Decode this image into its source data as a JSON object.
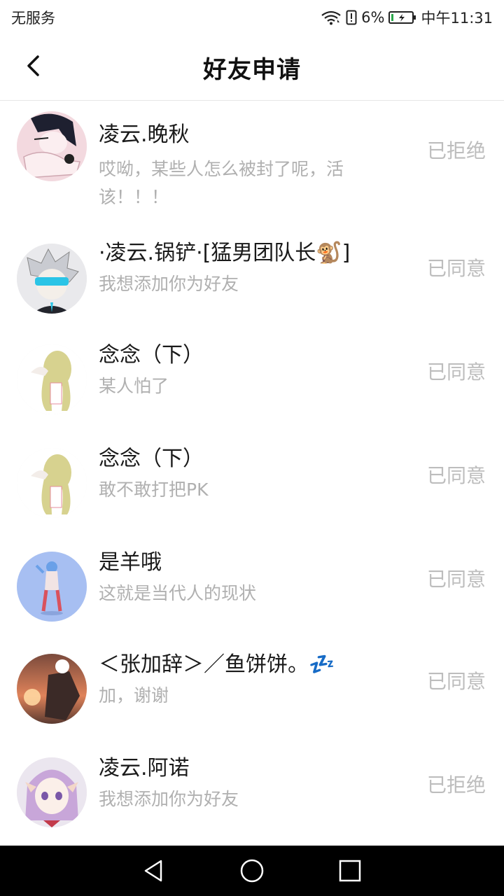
{
  "status_bar": {
    "carrier": "无服务",
    "battery_percent": "6%",
    "time": "中午11:31",
    "icons": [
      "wifi-icon",
      "alert-icon",
      "battery-icon"
    ]
  },
  "header": {
    "title": "好友申请",
    "back_icon": "chevron-left-icon"
  },
  "requests": [
    {
      "name": "凌云.晚秋",
      "message": "哎呦，某些人怎么被封了呢，活该！！！",
      "status": "已拒绝",
      "avatar": "anime-girl-avatar"
    },
    {
      "name": "·凌云.锅铲·[猛男团队长🐒]",
      "message": "我想添加你为好友",
      "status": "已同意",
      "avatar": "silver-hair-avatar"
    },
    {
      "name": "念念（下）",
      "message": "某人怕了",
      "status": "已同意",
      "avatar": "blonde-girl-avatar"
    },
    {
      "name": "念念（下）",
      "message": "敢不敢打把PK",
      "status": "已同意",
      "avatar": "blonde-girl-avatar"
    },
    {
      "name": "是羊哦",
      "message": "这就是当代人的现状",
      "status": "已同意",
      "avatar": "blue-character-avatar"
    },
    {
      "name": "＜张加辞＞／鱼饼饼。💤",
      "message": "加，谢谢",
      "status": "已同意",
      "avatar": "sunset-avatar"
    },
    {
      "name": "凌云.阿诺",
      "message": "我想添加你为好友",
      "status": "已拒绝",
      "avatar": "purple-hair-avatar"
    }
  ],
  "nav_bar": {
    "icons": [
      "back-triangle-icon",
      "home-circle-icon",
      "recents-square-icon"
    ]
  },
  "colors": {
    "status_text": "#bdbdbd",
    "message_text": "#b0b0b0",
    "name_text": "#1a1a1a",
    "nav_background": "#000000"
  }
}
